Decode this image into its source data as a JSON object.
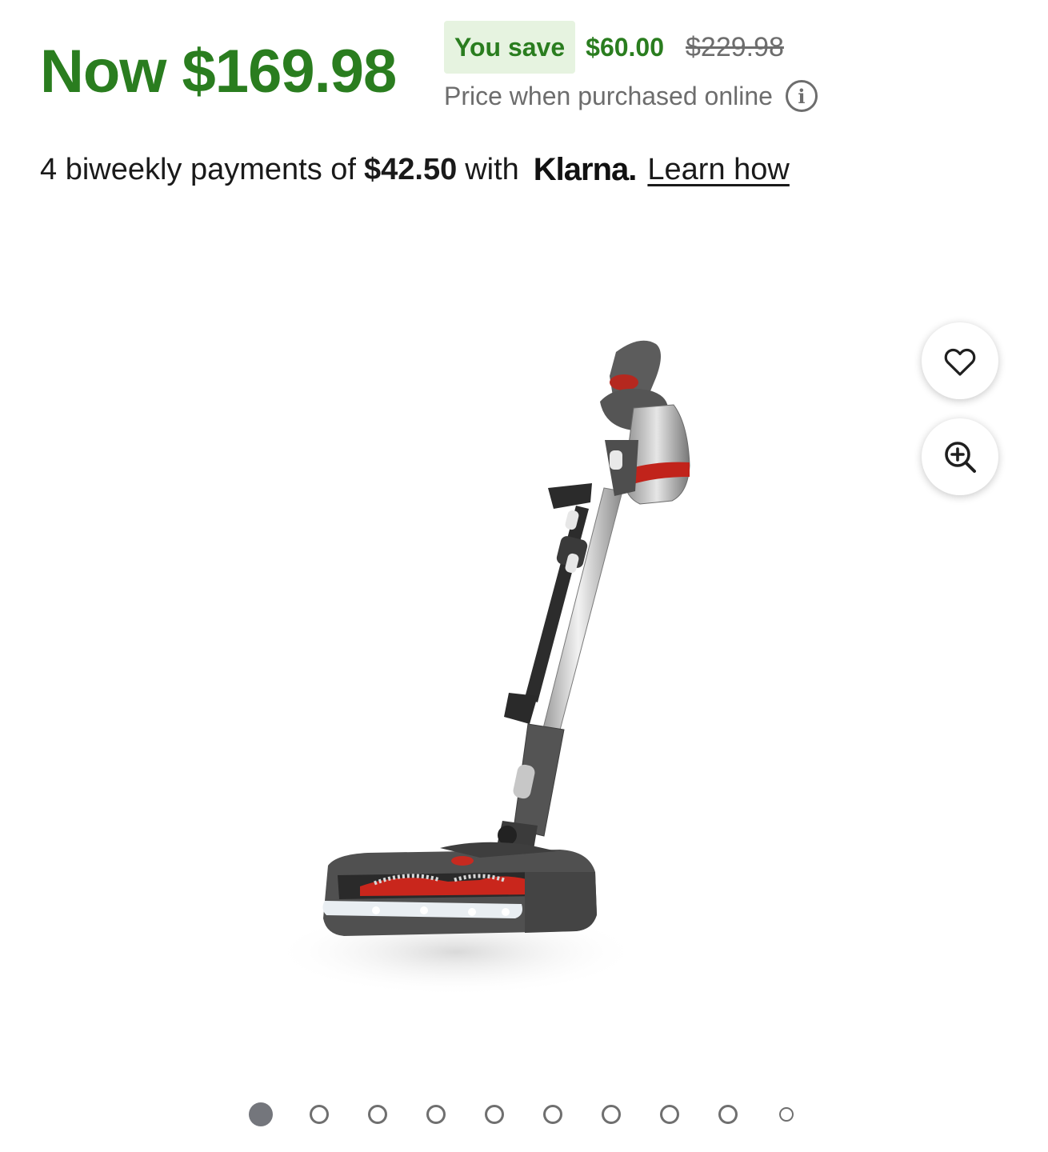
{
  "price": {
    "now": "Now $169.98",
    "save_label": "You save",
    "save_amount": "$60.00",
    "was": "$229.98",
    "note": "Price when purchased online"
  },
  "klarna": {
    "prefix": "4 biweekly payments of",
    "amount": "$42.50",
    "with": "with",
    "logo": "Klarna.",
    "link": "Learn how"
  },
  "icons": {
    "info": "info-icon",
    "favorite": "heart-icon",
    "zoom": "zoom-in-icon"
  },
  "carousel": {
    "total": 10,
    "active_index": 0
  },
  "colors": {
    "price_green": "#2a7d1f",
    "save_badge_bg": "#e6f3e0",
    "muted_text": "#6d6d6d"
  }
}
